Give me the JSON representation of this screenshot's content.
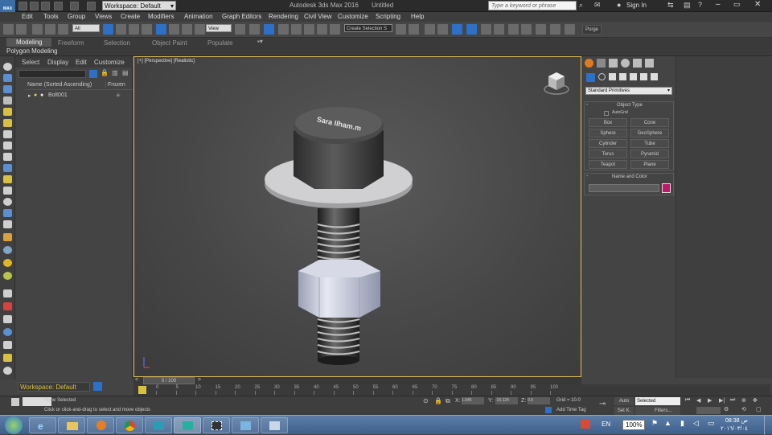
{
  "titlebar": {
    "workspace": "Workspace: Default",
    "app_title": "Autodesk 3ds Max 2016",
    "doc_title": "Untitled",
    "search_placeholder": "Type a keyword or phrase",
    "sign_in": "Sign In",
    "logo": "MAX"
  },
  "menu": [
    "Edit",
    "Tools",
    "Group",
    "Views",
    "Create",
    "Modifiers",
    "Animation",
    "Graph Editors",
    "Rendering",
    "Civil View",
    "Customize",
    "Scripting",
    "Help"
  ],
  "toolbar": {
    "filter": "All",
    "view": "View",
    "selection_set": "Create Selection S",
    "purge": "Purge"
  },
  "ribbon": {
    "tabs": [
      "Modeling",
      "Freeform",
      "Selection",
      "Object Paint",
      "Populate"
    ],
    "sub": "Polygon Modeling"
  },
  "explorer": {
    "tabs": [
      "Select",
      "Display",
      "Edit",
      "Customize"
    ],
    "col_name": "Name (Sorted Ascending)",
    "col_frozen": "Frozen",
    "items": [
      "Bolt001"
    ],
    "workspace": "Workspace: Default"
  },
  "viewport": {
    "label": "[+] [Perspective] [Realistic]",
    "bolt_text": "Sara Ilham.m"
  },
  "command_panel": {
    "category": "Standard Primitives",
    "object_type_title": "Object Type",
    "autogrid": "AutoGrid",
    "buttons": [
      "Box",
      "Cone",
      "Sphere",
      "GeoSphere",
      "Cylinder",
      "Tube",
      "Torus",
      "Pyramid",
      "Teapot",
      "Plane"
    ],
    "name_color_title": "Name and Color",
    "color": "#c2186b"
  },
  "timeline": {
    "slider": "0 / 100",
    "ticks": [
      "0",
      "5",
      "10",
      "15",
      "20",
      "25",
      "30",
      "35",
      "40",
      "45",
      "50",
      "55",
      "60",
      "65",
      "70",
      "75",
      "80",
      "85",
      "90",
      "95",
      "100"
    ]
  },
  "status": {
    "selection": "None Selected",
    "prompt": "Click or click-and-drag to select and move objects",
    "x_label": "X:",
    "x_value": "1.045",
    "y_label": "Y:",
    "y_value": "-15.124",
    "z_label": "Z:",
    "z_value": "0.0",
    "grid": "Grid = 10.0",
    "add_time_tag": "Add Time Tag",
    "auto": "Auto",
    "set_key": "Set K.",
    "key_mode": "Selected",
    "filters": "Filters..."
  },
  "taskbar": {
    "lang": "EN",
    "battery": "100%",
    "time": "08:38 ص",
    "date": "٢٠١٦/٠٣/٠٤"
  },
  "colors": {
    "accent": "#2d70c8",
    "viewport_border": "#e0c060",
    "taskbar": "#4a6d98"
  }
}
